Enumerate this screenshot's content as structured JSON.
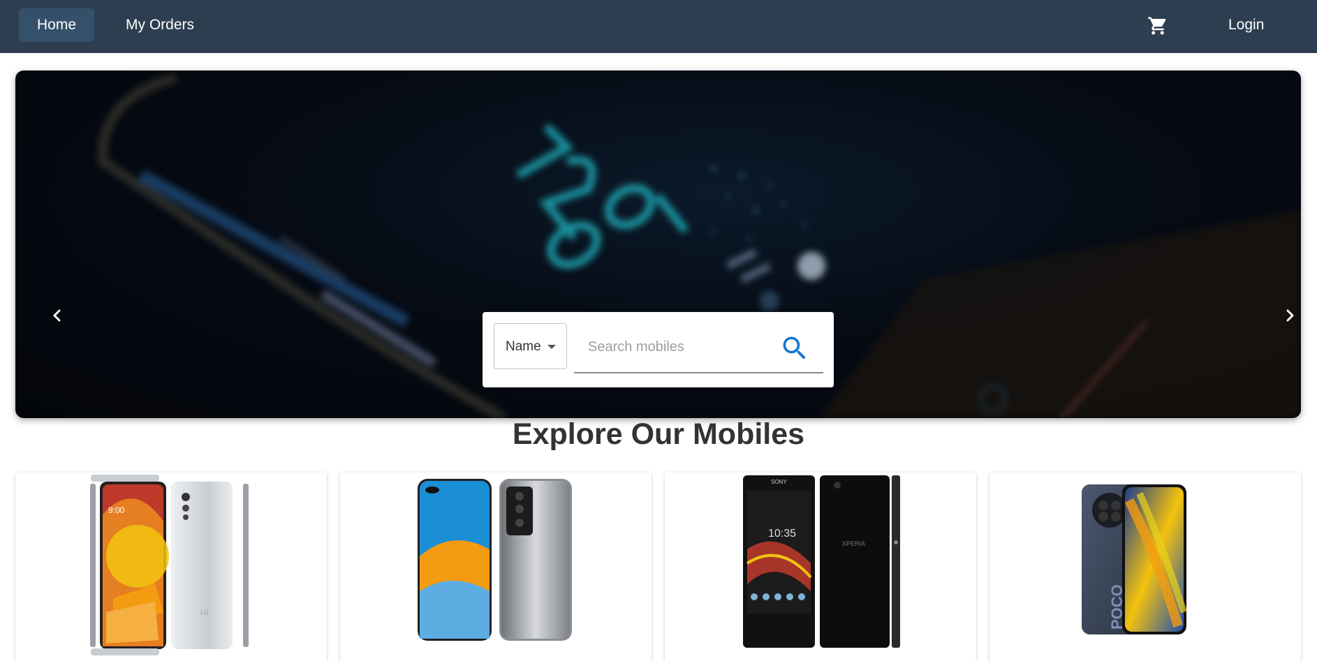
{
  "navbar": {
    "home_label": "Home",
    "orders_label": "My Orders",
    "cart_icon": "shopping-cart-icon",
    "login_label": "Login"
  },
  "hero": {
    "prev_icon": "chevron-left-icon",
    "next_icon": "chevron-right-icon"
  },
  "search": {
    "filter_selected": "Name",
    "placeholder": "Search mobiles",
    "value": "",
    "search_icon": "search-icon"
  },
  "section": {
    "title": "Explore Our Mobiles"
  },
  "products": [
    {
      "image_alt": "lg-velvet-phone"
    },
    {
      "image_alt": "huawei-p40-phone"
    },
    {
      "image_alt": "sony-xperia-phone"
    },
    {
      "image_alt": "poco-x3-phone"
    }
  ],
  "colors": {
    "navbar_bg": "#2c3e50",
    "active_nav_bg": "#35506a",
    "search_accent": "#1976d2",
    "title_text": "#333333"
  }
}
